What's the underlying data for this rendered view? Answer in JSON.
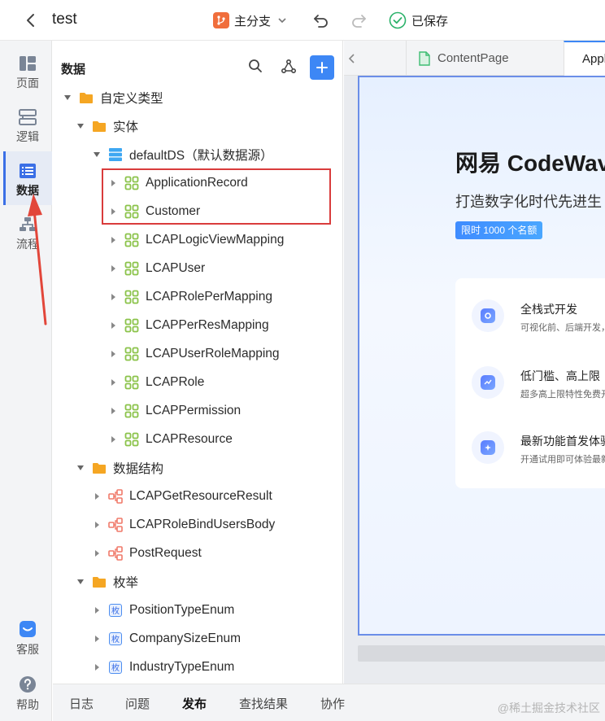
{
  "header": {
    "title": "test",
    "branch_label": "主分支",
    "saved_label": "已保存"
  },
  "rail": {
    "items": [
      {
        "label": "页面",
        "icon": "page-icon"
      },
      {
        "label": "逻辑",
        "icon": "logic-icon"
      },
      {
        "label": "数据",
        "icon": "data-icon"
      },
      {
        "label": "流程",
        "icon": "process-icon"
      }
    ],
    "bottom": [
      {
        "label": "客服",
        "icon": "support-icon"
      },
      {
        "label": "帮助",
        "icon": "help-icon"
      }
    ],
    "active_index": 2
  },
  "panel": {
    "title": "数据",
    "tree": [
      {
        "label": "自定义类型",
        "type": "folder",
        "expanded": true
      },
      {
        "label": "实体",
        "type": "folder",
        "expanded": true
      },
      {
        "label": "defaultDS（默认数据源）",
        "type": "datasource",
        "expanded": true
      },
      {
        "label": "ApplicationRecord",
        "type": "entity"
      },
      {
        "label": "Customer",
        "type": "entity"
      },
      {
        "label": "LCAPLogicViewMapping",
        "type": "entity"
      },
      {
        "label": "LCAPUser",
        "type": "entity"
      },
      {
        "label": "LCAPRolePerMapping",
        "type": "entity"
      },
      {
        "label": "LCAPPerResMapping",
        "type": "entity"
      },
      {
        "label": "LCAPUserRoleMapping",
        "type": "entity"
      },
      {
        "label": "LCAPRole",
        "type": "entity"
      },
      {
        "label": "LCAPPermission",
        "type": "entity"
      },
      {
        "label": "LCAPResource",
        "type": "entity"
      },
      {
        "label": "数据结构",
        "type": "folder",
        "expanded": true
      },
      {
        "label": "LCAPGetResourceResult",
        "type": "structure"
      },
      {
        "label": "LCAPRoleBindUsersBody",
        "type": "structure"
      },
      {
        "label": "PostRequest",
        "type": "structure"
      },
      {
        "label": "枚举",
        "type": "folder",
        "expanded": true
      },
      {
        "label": "PositionTypeEnum",
        "type": "enum"
      },
      {
        "label": "CompanySizeEnum",
        "type": "enum"
      },
      {
        "label": "IndustryTypeEnum",
        "type": "enum"
      }
    ],
    "enum_badge": "枚"
  },
  "bottom_tabs": [
    "日志",
    "问题",
    "发布",
    "查找结果",
    "协作"
  ],
  "bottom_active": 2,
  "watermark": "@稀土掘金技术社区",
  "editor": {
    "tabs": [
      {
        "label": "ContentPage",
        "active": false
      },
      {
        "label": "Appli",
        "active": true
      }
    ],
    "canvas": {
      "title": "网易 CodeWav",
      "subtitle": "打造数字化时代先进生",
      "badge": "限时 1000 个名额",
      "features": [
        {
          "title": "全栈式开发",
          "desc": "可视化前、后端开发，"
        },
        {
          "title": "低门槛、高上限",
          "desc": "超多高上限特性免费开"
        },
        {
          "title": "最新功能首发体验",
          "desc": "开通试用即可体验最新"
        }
      ]
    }
  },
  "colors": {
    "accent": "#3d87f5",
    "folder": "#f5a623",
    "entity": "#8bc34a",
    "structure": "#f07a6a",
    "highlight": "#d93c3c"
  }
}
